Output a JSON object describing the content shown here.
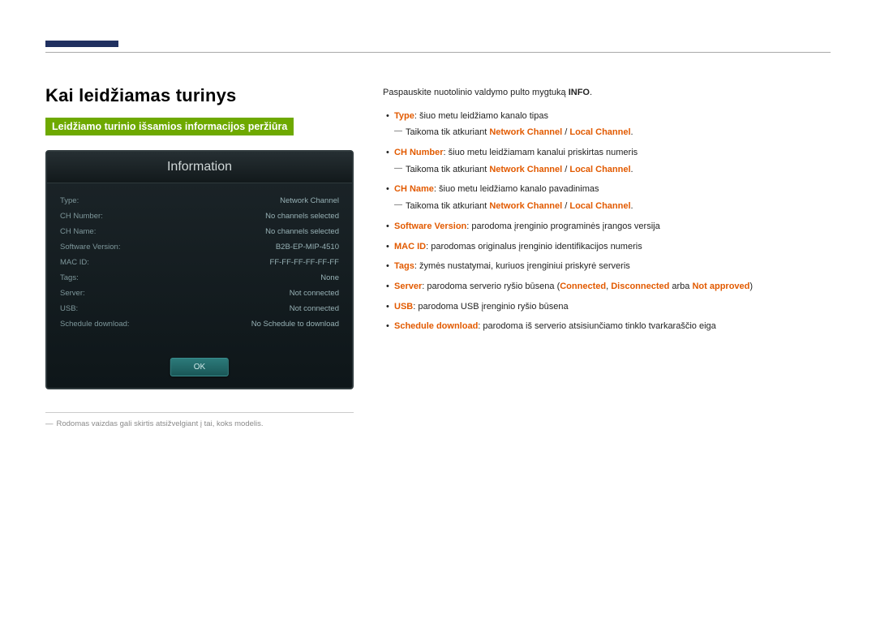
{
  "page": {
    "title": "Kai leidžiamas turinys",
    "section_title": "Leidžiamo turinio išsamios informacijos peržiūra"
  },
  "mock": {
    "title": "Information",
    "rows": [
      {
        "label": "Type:",
        "value": "Network Channel"
      },
      {
        "label": "CH Number:",
        "value": "No channels selected"
      },
      {
        "label": "CH Name:",
        "value": "No channels selected"
      },
      {
        "label": "Software Version:",
        "value": "B2B-EP-MIP-4510"
      },
      {
        "label": "MAC ID:",
        "value": "FF-FF-FF-FF-FF-FF"
      },
      {
        "label": "Tags:",
        "value": "None"
      },
      {
        "label": "Server:",
        "value": "Not connected"
      },
      {
        "label": "USB:",
        "value": "Not connected"
      },
      {
        "label": "Schedule download:",
        "value": "No Schedule to download"
      }
    ],
    "ok": "OK"
  },
  "footnote": {
    "text": "Rodomas vaizdas gali skirtis atsižvelgiant į tai, koks modelis."
  },
  "right": {
    "intro_prefix": "Paspauskite nuotolinio valdymo pulto mygtuką ",
    "intro_bold": "INFO",
    "intro_suffix": ".",
    "note_prefix": "Taikoma tik atkuriant ",
    "note_nc": "Network Channel",
    "note_sep": " / ",
    "note_lc": "Local Channel",
    "note_suffix": ".",
    "items": {
      "type_key": "Type",
      "type_rest": ": šiuo metu leidžiamo kanalo tipas",
      "chnum_key": "CH Number",
      "chnum_rest": ": šiuo metu leidžiamam kanalui priskirtas numeris",
      "chname_key": "CH Name",
      "chname_rest": ": šiuo metu leidžiamo kanalo pavadinimas",
      "sw_key": "Software Version",
      "sw_rest": ": parodoma įrenginio programinės įrangos versija",
      "mac_key": "MAC ID",
      "mac_rest": ": parodomas originalus įrenginio identifikacijos numeris",
      "tags_key": "Tags",
      "tags_rest": ": žymės nustatymai, kuriuos įrenginiui priskyrė serveris",
      "server_key": "Server",
      "server_rest_a": ": parodoma serverio ryšio būsena (",
      "server_conn": "Connected",
      "server_c1": ", ",
      "server_disc": "Disconnected",
      "server_c2": " arba ",
      "server_na": "Not approved",
      "server_c3": ")",
      "usb_key": "USB",
      "usb_rest": ": parodoma USB įrenginio ryšio būsena",
      "sched_key": "Schedule download",
      "sched_rest": ": parodoma iš serverio atsisiunčiamo tinklo tvarkaraščio eiga"
    }
  }
}
